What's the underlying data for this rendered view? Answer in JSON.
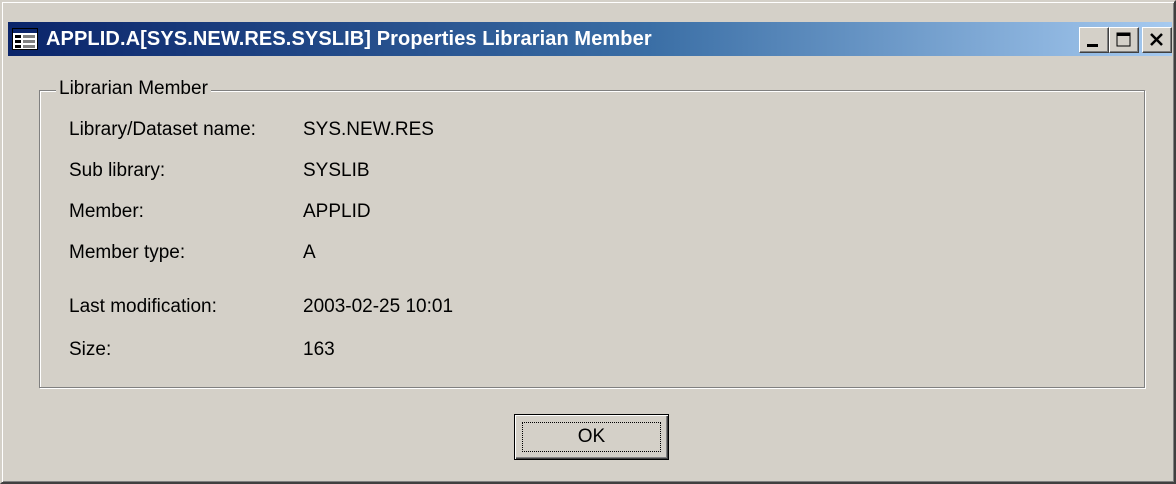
{
  "window": {
    "title": "APPLID.A[SYS.NEW.RES.SYSLIB] Properties Librarian Member",
    "icon": "properties-grid-icon",
    "controls": [
      "minimize-icon",
      "maximize-icon",
      "close-icon"
    ]
  },
  "group": {
    "title": "Librarian Member"
  },
  "fields": [
    {
      "label": "Library/Dataset name:",
      "value": "SYS.NEW.RES"
    },
    {
      "label": "Sub library:",
      "value": "SYSLIB"
    },
    {
      "label": "Member:",
      "value": "APPLID"
    },
    {
      "label": "Member type:",
      "value": "A"
    },
    {
      "label": "Last modification:",
      "value": "2003-02-25 10:01"
    },
    {
      "label": "Size:",
      "value": "163"
    }
  ],
  "buttons": {
    "ok": "OK"
  },
  "colors": {
    "face": "#d4d0c8",
    "title_start": "#0a246a",
    "title_end": "#a6caf0"
  }
}
